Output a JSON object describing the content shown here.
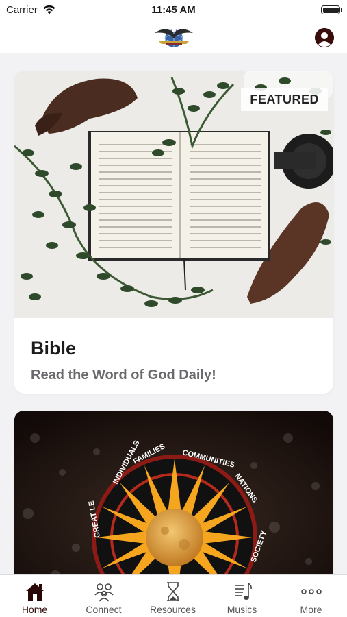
{
  "status_bar": {
    "carrier": "Carrier",
    "time": "11:45 AM",
    "battery_level": 1.0
  },
  "header": {
    "logo_icon": "globe-eagle-logo",
    "profile_icon": "profile-icon"
  },
  "cards": [
    {
      "badge": "FEATURED",
      "title": "Bible",
      "subtitle": "Read the Word of God Daily!",
      "image": "open-bible-with-plants-photo"
    },
    {
      "image": "sun-emblem-photo",
      "emblem_text": "INDIVIDUALS * FAMILIES * COMMUNITIES * NATIONS",
      "emblem_text_bottom": "GREAT LE... SOCIETY"
    }
  ],
  "tab_bar": {
    "tabs": [
      {
        "label": "Home",
        "icon": "home-icon",
        "active": true
      },
      {
        "label": "Connect",
        "icon": "people-icon",
        "active": false
      },
      {
        "label": "Resources",
        "icon": "hourglass-icon",
        "active": false
      },
      {
        "label": "Musics",
        "icon": "music-notes-icon",
        "active": false
      },
      {
        "label": "More",
        "icon": "more-dots-icon",
        "active": false
      }
    ]
  },
  "colors": {
    "accent": "#2a0707",
    "background": "#f2f2f4",
    "subtitle": "#6a6a6e"
  }
}
